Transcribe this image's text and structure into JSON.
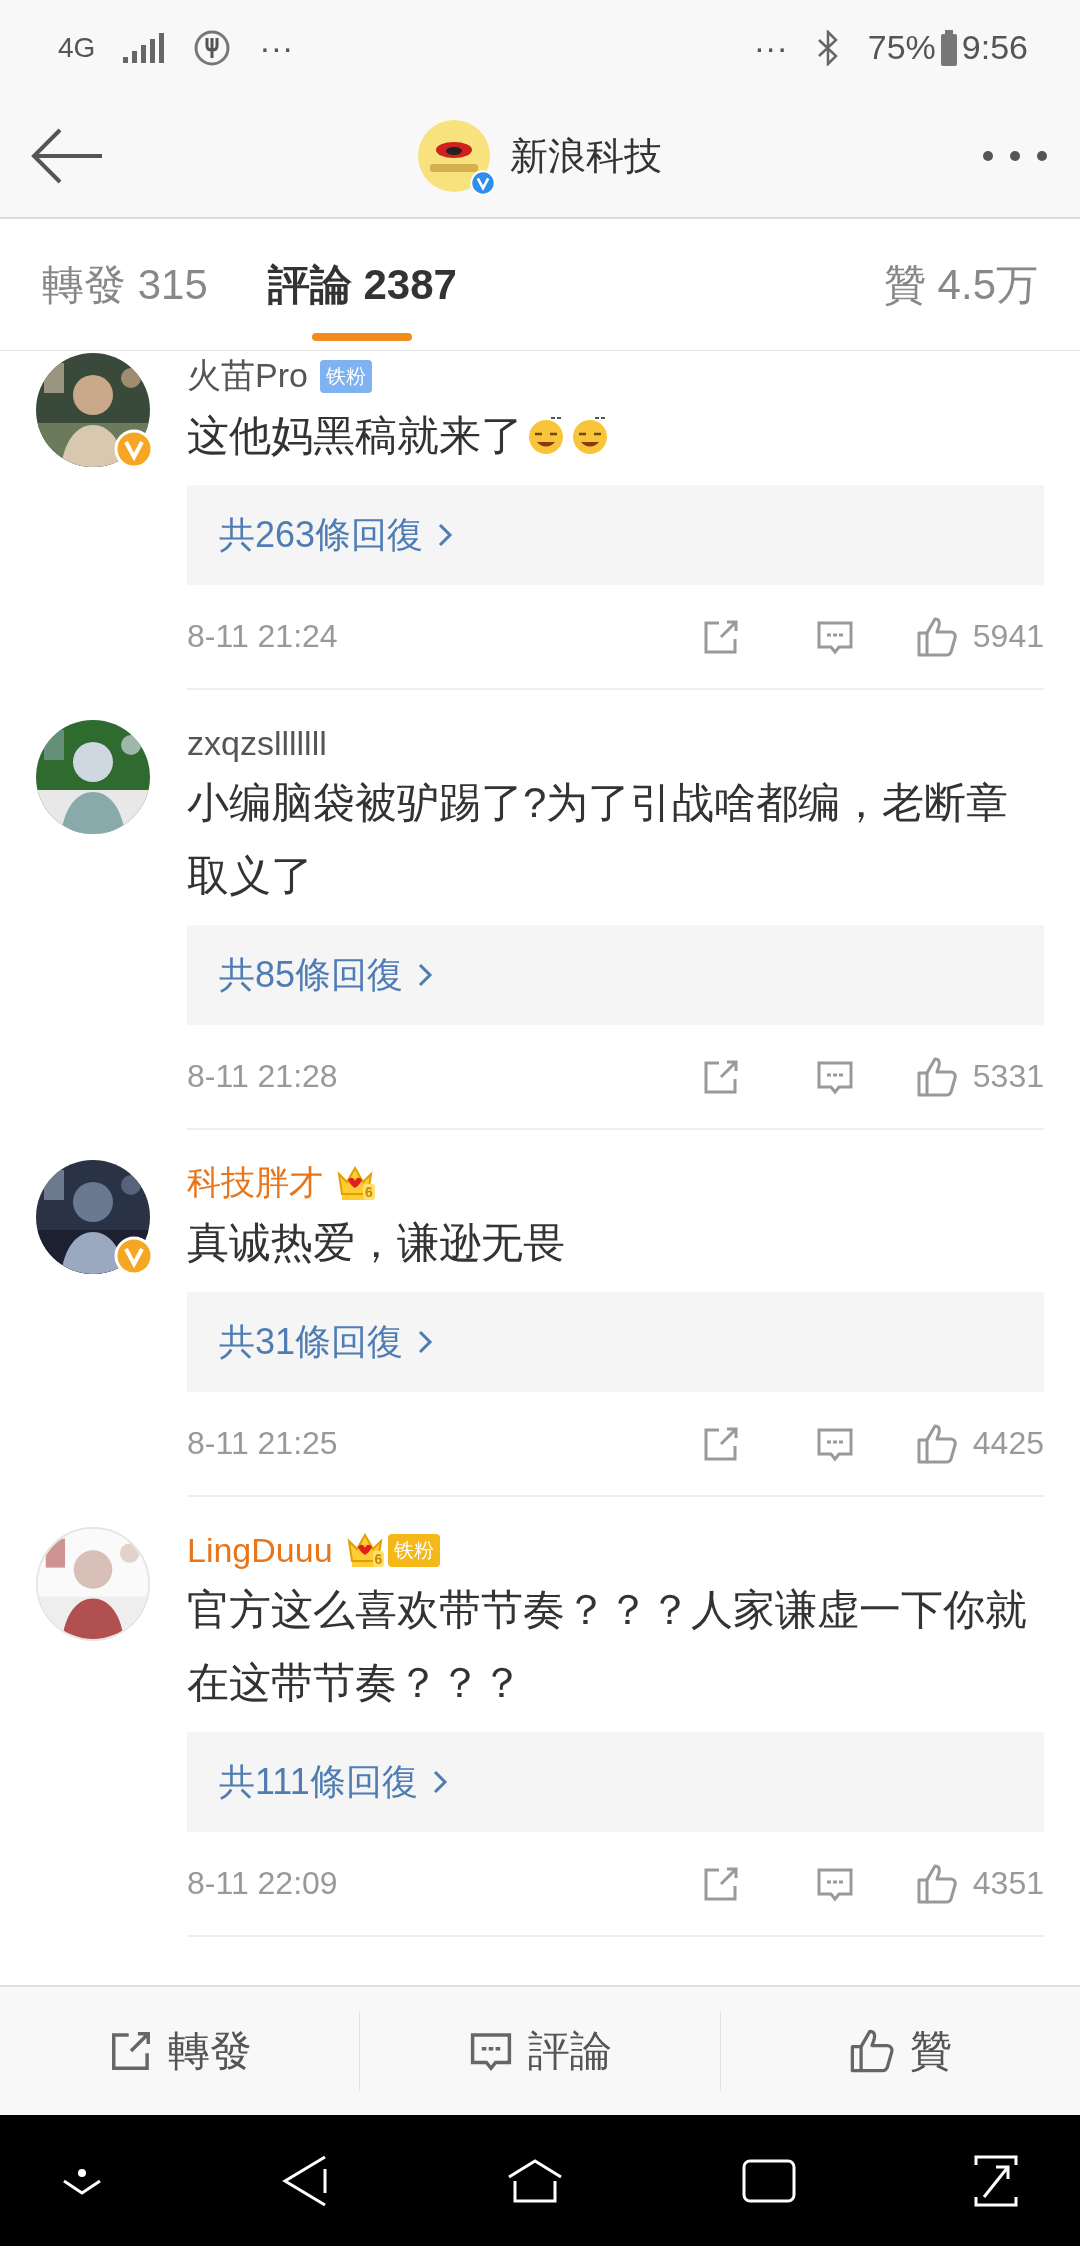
{
  "status_bar": {
    "network": "4G",
    "left_more": "···",
    "right_more": "···",
    "battery": "75%",
    "time": "9:56"
  },
  "header": {
    "title": "新浪科技",
    "verified": true
  },
  "tabs": [
    {
      "label": "轉發 315",
      "selected": false
    },
    {
      "label": "評論 2387",
      "selected": true
    },
    {
      "label": "贊 4.5万",
      "selected": false
    }
  ],
  "comments": [
    {
      "name": "火苗Pro",
      "member": false,
      "verified": true,
      "badges": [
        {
          "kind": "fan",
          "label": "铁粉"
        }
      ],
      "text": "这他妈黑稿就来了",
      "stickers": [
        {
          "kind": "sticker"
        },
        {
          "kind": "sticker"
        }
      ],
      "replies": "共263條回復",
      "time": "8-11 21:24",
      "likes": "5941"
    },
    {
      "name": "zxqzslllllll",
      "member": false,
      "verified": false,
      "text": "小编脑袋被驴踢了?为了引战啥都编，老断章取义了",
      "replies": "共85條回復",
      "time": "8-11 21:28",
      "likes": "5331"
    },
    {
      "name": "科技胖才",
      "member": true,
      "verified": true,
      "badges": [
        {
          "kind": "crown",
          "level": "6"
        }
      ],
      "text": "真诚热爱，谦逊无畏",
      "replies": "共31條回復",
      "time": "8-11 21:25",
      "likes": "4425"
    },
    {
      "name": "LingDuuu",
      "member": true,
      "verified": false,
      "badges": [
        {
          "kind": "crown_fan",
          "level": "6",
          "label": "铁粉"
        }
      ],
      "text": "官方这么喜欢带节奏？？？人家谦虚一下你就在这带节奏？？？",
      "replies": "共111條回復",
      "time": "8-11 22:09",
      "likes": "4351"
    }
  ],
  "actions": [
    {
      "kind": "repost",
      "label": "轉發"
    },
    {
      "kind": "comment",
      "label": "評論"
    },
    {
      "kind": "like",
      "label": "贊"
    }
  ]
}
